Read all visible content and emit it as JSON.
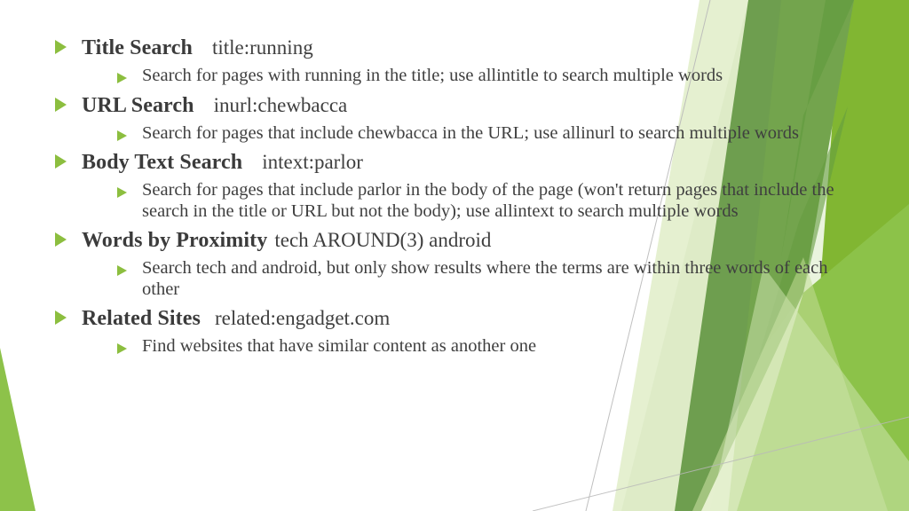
{
  "slide": {
    "type": "presentation-slide",
    "theme": {
      "background": "#FFFFFF",
      "bullet_color": "#8CBE3F",
      "heading_color": "#3B3B3B",
      "body_color": "#3F3F3F",
      "accent_bright_green": "#7FB42E",
      "accent_green": "#6E9E4F",
      "accent_light_green": "#8DC24A",
      "accent_pale_green": "#E4EFCE",
      "accent_dark_green": "#5E9440",
      "hairline_color": "#B9B9B9"
    },
    "bullets": [
      {
        "title": "Title Search",
        "example": "title:running",
        "gap": "wide",
        "details": [
          "Search for pages with running in the title; use allintitle to search multiple words"
        ]
      },
      {
        "title": "URL Search",
        "example": "inurl:chewbacca",
        "gap": "wide",
        "details": [
          "Search for pages that include chewbacca in the URL; use allinurl to search multiple words"
        ]
      },
      {
        "title": "Body Text Search",
        "example": "intext:parlor",
        "gap": "wide",
        "details": [
          "Search for pages that include parlor in the body of the page (won't return pages that include the search in the title or URL but not the body); use allintext to search multiple words"
        ]
      },
      {
        "title": "Words by Proximity",
        "example": "tech AROUND(3) android",
        "gap": "narrow",
        "details": [
          "Search tech and android, but only show results where the terms are within three words of each other"
        ]
      },
      {
        "title": "Related Sites",
        "example": "related:engadget.com",
        "gap": "med",
        "details": [
          "Find websites that have similar content as another one"
        ]
      }
    ]
  }
}
